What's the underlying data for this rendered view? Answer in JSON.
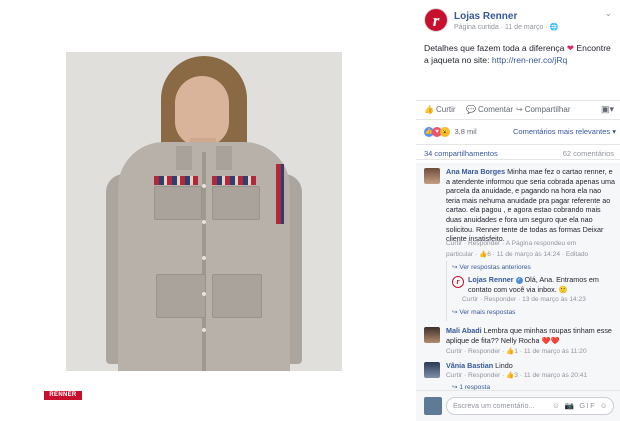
{
  "brand_badge": "RENNER",
  "post": {
    "page_name": "Lojas Renner",
    "page_meta": "Página curtida · 11 de março · 🌐",
    "text_before": "Detalhes que fazem toda a diferença ",
    "text_after": " Encontre a jaqueta no site: ",
    "link": "http://ren-ner.co/jRq"
  },
  "actions": {
    "like": "Curtir",
    "comment": "Comentar",
    "share": "Compartilhar"
  },
  "reactions": {
    "count": "3,8 mil",
    "sort": "Comentários mais relevantes ▾"
  },
  "counts": {
    "shares": "34 compartilhamentos",
    "comments": "62 comentários"
  },
  "comments": [
    {
      "author": "Ana Mara Borges",
      "text": " Minha mae fez o cartao renner, e a atendente informou que seria cobrada apenas uma parcela da anuidade, e pagando na hora ela nao teria mais nehuma anuidade pra pagar referente ao cartao. ela pagou , e agora estao cobrando mais duas anuidades e fora um seguro que ela nao solicitou. Renner tente de todas as formas Deixar cliente insatisfeito.",
      "actions_line1": "Curtir · Responder · A Página respondeu em",
      "actions_line2": "particular · 👍6 · 11 de março às 14:24 · Editado"
    },
    {
      "text": "↪ Ver respostas anteriores"
    },
    {
      "author": "Lojas Renner",
      "text": " Olá, Ana. Entramos em contato com você via inbox. 🙂",
      "actions": "Curtir · Responder · 13 de março às 14:23"
    },
    {
      "text": "↪ Ver mais respostas"
    },
    {
      "author": "Mali Abadi",
      "text": " Lembra que minhas roupas tinham esse aplique de fita?? Nelly Rocha ❤️❤️",
      "actions": "Curtir · Responder · 👍1 · 11 de março às 11:20"
    },
    {
      "author": "Vânia Bastian",
      "text": " Lindo",
      "actions": "Curtir · Responder · 👍3 · 11 de março às 20:41"
    },
    {
      "text": "↪ 1 resposta"
    }
  ],
  "composer": {
    "placeholder": "Escreva um comentário...",
    "tools": "☺ 📷 GIF ☺"
  },
  "colors": {
    "brand_red": "#c8102e",
    "link_blue": "#365899",
    "muted": "#90949c"
  }
}
